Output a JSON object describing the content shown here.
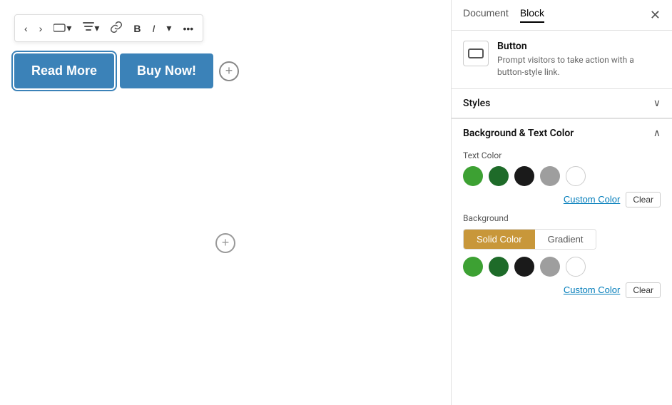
{
  "panel": {
    "tabs": [
      {
        "label": "Document",
        "active": false
      },
      {
        "label": "Block",
        "active": true
      }
    ],
    "close_label": "×"
  },
  "block_info": {
    "name": "Button",
    "description": "Prompt visitors to take action with a button-style link."
  },
  "styles_section": {
    "title": "Styles",
    "chevron": "∨"
  },
  "bg_text_section": {
    "title": "Background & Text Color",
    "chevron": "∧"
  },
  "text_color": {
    "label": "Text Color",
    "swatches": [
      {
        "color": "#3da133",
        "selected": false
      },
      {
        "color": "#1e6b29",
        "selected": false
      },
      {
        "color": "#1a1a1a",
        "selected": false
      },
      {
        "color": "#9e9e9e",
        "selected": false
      },
      {
        "color": "#ffffff",
        "selected": false,
        "white": true
      }
    ],
    "custom_label": "Custom Color",
    "clear_label": "Clear"
  },
  "background": {
    "label": "Background",
    "toggle": [
      {
        "label": "Solid Color",
        "active": true
      },
      {
        "label": "Gradient",
        "active": false
      }
    ],
    "swatches": [
      {
        "color": "#3da133",
        "selected": false
      },
      {
        "color": "#1e6b29",
        "selected": false
      },
      {
        "color": "#1a1a1a",
        "selected": false
      },
      {
        "color": "#9e9e9e",
        "selected": false
      },
      {
        "color": "#ffffff",
        "selected": false,
        "white": true
      }
    ],
    "custom_label": "Custom Color",
    "clear_label": "Clear"
  },
  "toolbar": {
    "back_label": "‹",
    "forward_label": "›",
    "block_type_label": "▭▾",
    "align_label": "≡▾",
    "link_label": "🔗",
    "bold_label": "B",
    "italic_label": "I",
    "more_label": "⋯",
    "format_label": "▾"
  },
  "buttons": {
    "read_more": "Read More",
    "buy_now": "Buy Now!"
  }
}
